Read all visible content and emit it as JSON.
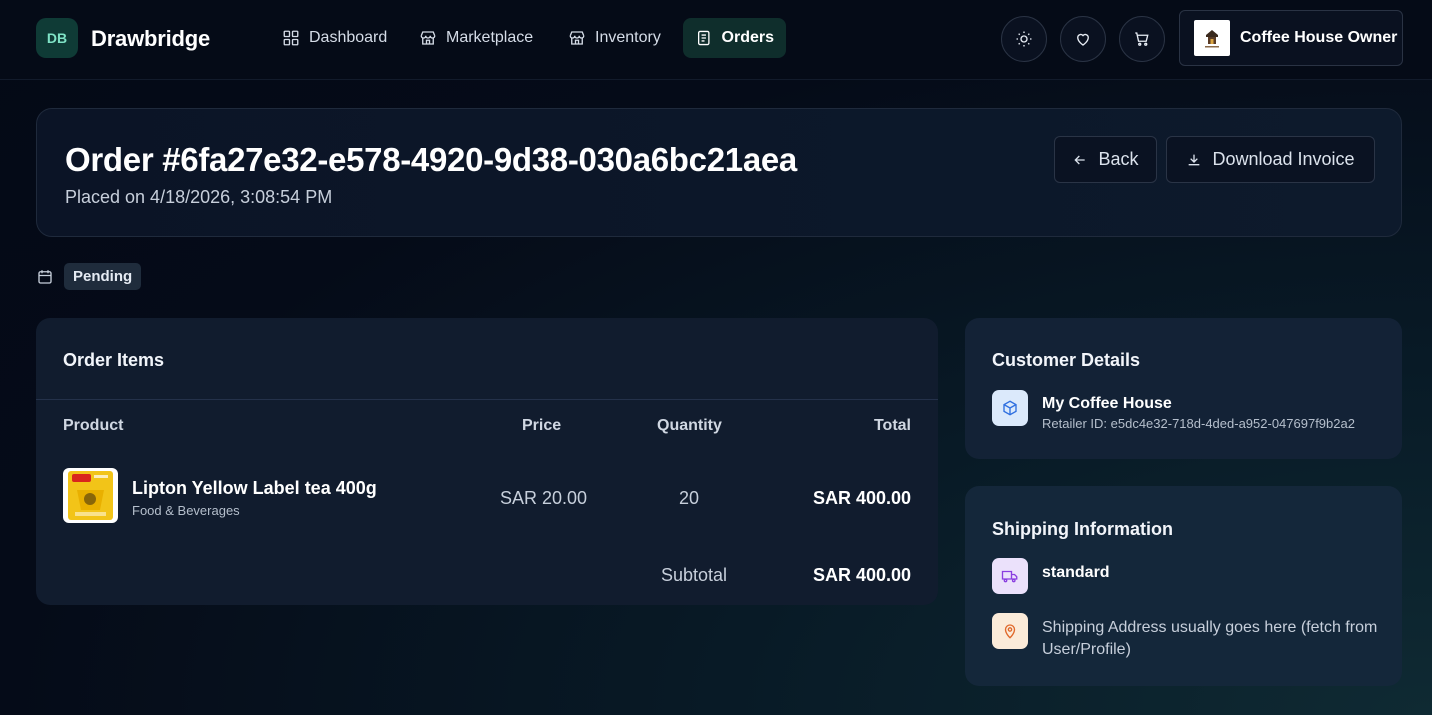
{
  "header": {
    "logo_text": "DB",
    "brand": "Drawbridge",
    "nav": [
      {
        "label": "Dashboard",
        "icon": "grid-icon"
      },
      {
        "label": "Marketplace",
        "icon": "store-icon"
      },
      {
        "label": "Inventory",
        "icon": "store-icon"
      },
      {
        "label": "Orders",
        "icon": "document-icon",
        "active": true
      }
    ],
    "profile_name": "Coffee House Owner"
  },
  "order": {
    "title": "Order #6fa27e32-e578-4920-9d38-030a6bc21aea",
    "placed_on": "Placed on 4/18/2026, 3:08:54 PM",
    "status": "Pending",
    "back_label": "Back",
    "download_label": "Download Invoice"
  },
  "items": {
    "title": "Order Items",
    "columns": [
      "Product",
      "Price",
      "Quantity",
      "Total"
    ],
    "rows": [
      {
        "name": "Lipton Yellow Label tea 400g",
        "category": "Food & Beverages",
        "price": "SAR 20.00",
        "quantity": "20",
        "total": "SAR 400.00"
      }
    ],
    "subtotal_label": "Subtotal",
    "subtotal_value": "SAR 400.00"
  },
  "customer": {
    "title": "Customer Details",
    "name": "My Coffee House",
    "retailer_id": "Retailer ID: e5dc4e32-718d-4ded-a952-047697f9b2a2"
  },
  "shipping": {
    "title": "Shipping Information",
    "method": "standard",
    "address": "Shipping Address usually goes here (fetch from User/Profile)"
  },
  "colors": {
    "accent": "#7fe3c6",
    "background": "#050b17",
    "card": "#111c2e"
  }
}
